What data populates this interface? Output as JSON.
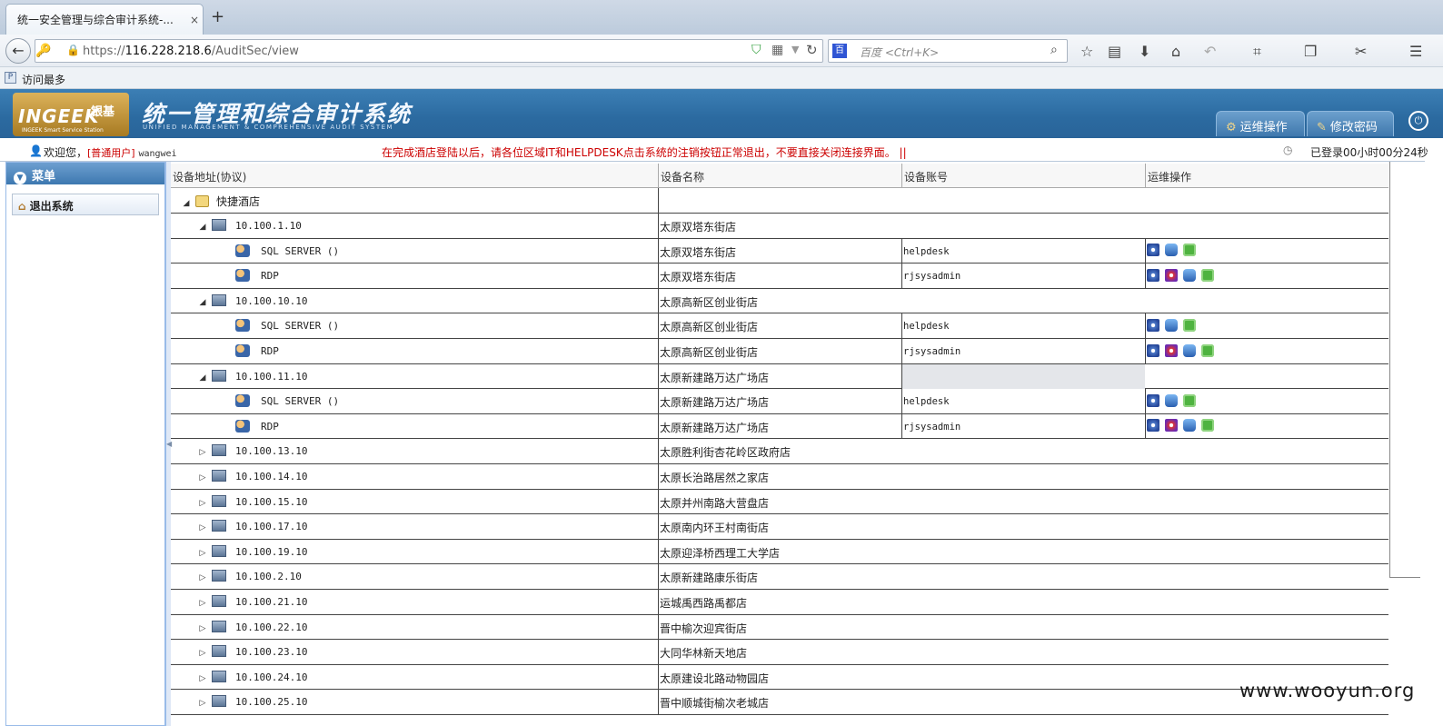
{
  "browser": {
    "tab_title": "统一安全管理与综合审计系统-...",
    "tab_close": "×",
    "new_tab": "+",
    "url_prefix": "https://",
    "url_host": "116.228.218.6",
    "url_path": "/AuditSec/view",
    "search_placeholder": "百度 <Ctrl+K>",
    "search_engine_glyph": "百",
    "bookmark_label": "访问最多",
    "bookmark_glyph": "P"
  },
  "header": {
    "logo_text": "INGEEK",
    "logo_cn": "银基",
    "logo_tag": "INGEEK Smart Service Station",
    "system_title": "统一管理和综合审计系统",
    "system_subtitle": "UNIFIED MANAGEMENT & COMPREHENSIVE AUDIT SYSTEM",
    "btn_ops": "运维操作",
    "btn_password": "修改密码",
    "power_glyph": "⏻"
  },
  "infobar": {
    "welcome": "欢迎您，",
    "role": "[普通用户]",
    "username": "wangwei",
    "notice": "在完成酒店登陆以后，请各位区域IT和HELPDESK点击系统的注销按钮正常退出，不要直接关闭连接界面。    ||",
    "login_time": "已登录00小时00分24秒"
  },
  "menu": {
    "title": "菜单",
    "items": [
      {
        "label": "退出系统"
      }
    ]
  },
  "grid": {
    "columns": [
      "设备地址(协议)",
      "设备名称",
      "设备账号",
      "运维操作"
    ],
    "root": "快捷酒店",
    "rows": [
      {
        "level": 1,
        "expanded": true,
        "addr": "10.100.1.10",
        "name": "太原双塔东街店"
      },
      {
        "level": 2,
        "addr": "SQL SERVER  ()",
        "name": "太原双塔东街店",
        "acct": "helpdesk",
        "ops": [
          "connect",
          "db",
          "plugin"
        ]
      },
      {
        "level": 2,
        "addr": "RDP",
        "name": "太原双塔东街店",
        "acct": "rjsysadmin",
        "ops": [
          "connect",
          "rdp",
          "db",
          "plugin"
        ]
      },
      {
        "level": 1,
        "expanded": true,
        "addr": "10.100.10.10",
        "name": "太原高新区创业街店"
      },
      {
        "level": 2,
        "addr": "SQL SERVER  ()",
        "name": "太原高新区创业街店",
        "acct": "helpdesk",
        "ops": [
          "connect",
          "db",
          "plugin"
        ]
      },
      {
        "level": 2,
        "addr": "RDP",
        "name": "太原高新区创业街店",
        "acct": "rjsysadmin",
        "ops": [
          "connect",
          "rdp",
          "db",
          "plugin"
        ]
      },
      {
        "level": 1,
        "expanded": true,
        "addr": "10.100.11.10",
        "name": "太原新建路万达广场店",
        "selected": true
      },
      {
        "level": 2,
        "addr": "SQL SERVER  ()",
        "name": "太原新建路万达广场店",
        "acct": "helpdesk",
        "ops": [
          "connect",
          "db",
          "plugin"
        ]
      },
      {
        "level": 2,
        "addr": "RDP",
        "name": "太原新建路万达广场店",
        "acct": "rjsysadmin",
        "ops": [
          "connect",
          "rdp",
          "db",
          "plugin"
        ]
      },
      {
        "level": 1,
        "expanded": false,
        "addr": "10.100.13.10",
        "name": "太原胜利街杏花岭区政府店"
      },
      {
        "level": 1,
        "expanded": false,
        "addr": "10.100.14.10",
        "name": "太原长治路居然之家店"
      },
      {
        "level": 1,
        "expanded": false,
        "addr": "10.100.15.10",
        "name": "太原并州南路大营盘店"
      },
      {
        "level": 1,
        "expanded": false,
        "addr": "10.100.17.10",
        "name": "太原南内环王村南街店"
      },
      {
        "level": 1,
        "expanded": false,
        "addr": "10.100.19.10",
        "name": "太原迎泽桥西理工大学店"
      },
      {
        "level": 1,
        "expanded": false,
        "addr": "10.100.2.10",
        "name": "太原新建路康乐街店"
      },
      {
        "level": 1,
        "expanded": false,
        "addr": "10.100.21.10",
        "name": "运城禹西路禹都店"
      },
      {
        "level": 1,
        "expanded": false,
        "addr": "10.100.22.10",
        "name": "晋中榆次迎宾街店"
      },
      {
        "level": 1,
        "expanded": false,
        "addr": "10.100.23.10",
        "name": "大同华林新天地店"
      },
      {
        "level": 1,
        "expanded": false,
        "addr": "10.100.24.10",
        "name": "太原建设北路动物园店"
      },
      {
        "level": 1,
        "expanded": false,
        "addr": "10.100.25.10",
        "name": "晋中顺城街榆次老城店"
      }
    ]
  },
  "watermark": "www.wooyun.org"
}
